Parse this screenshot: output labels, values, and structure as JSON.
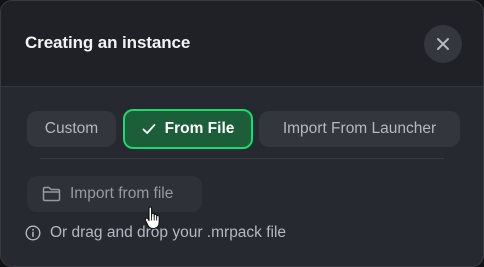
{
  "modal": {
    "title": "Creating an instance",
    "close_icon": "close-icon"
  },
  "tabs": [
    {
      "label": "Custom",
      "selected": false
    },
    {
      "label": "From File",
      "selected": true,
      "icon": "check-icon"
    },
    {
      "label": "Import From Launcher",
      "selected": false
    }
  ],
  "import_button": {
    "label": "Import from file",
    "icon": "folder-icon"
  },
  "hint": {
    "text": "Or drag and drop your .mrpack file",
    "icon": "info-icon"
  },
  "colors": {
    "accent": "#1bd96a",
    "selected_tab_bg": "#1c5e3a",
    "modal_bg": "#26292f",
    "header_bg": "#1f2126"
  }
}
